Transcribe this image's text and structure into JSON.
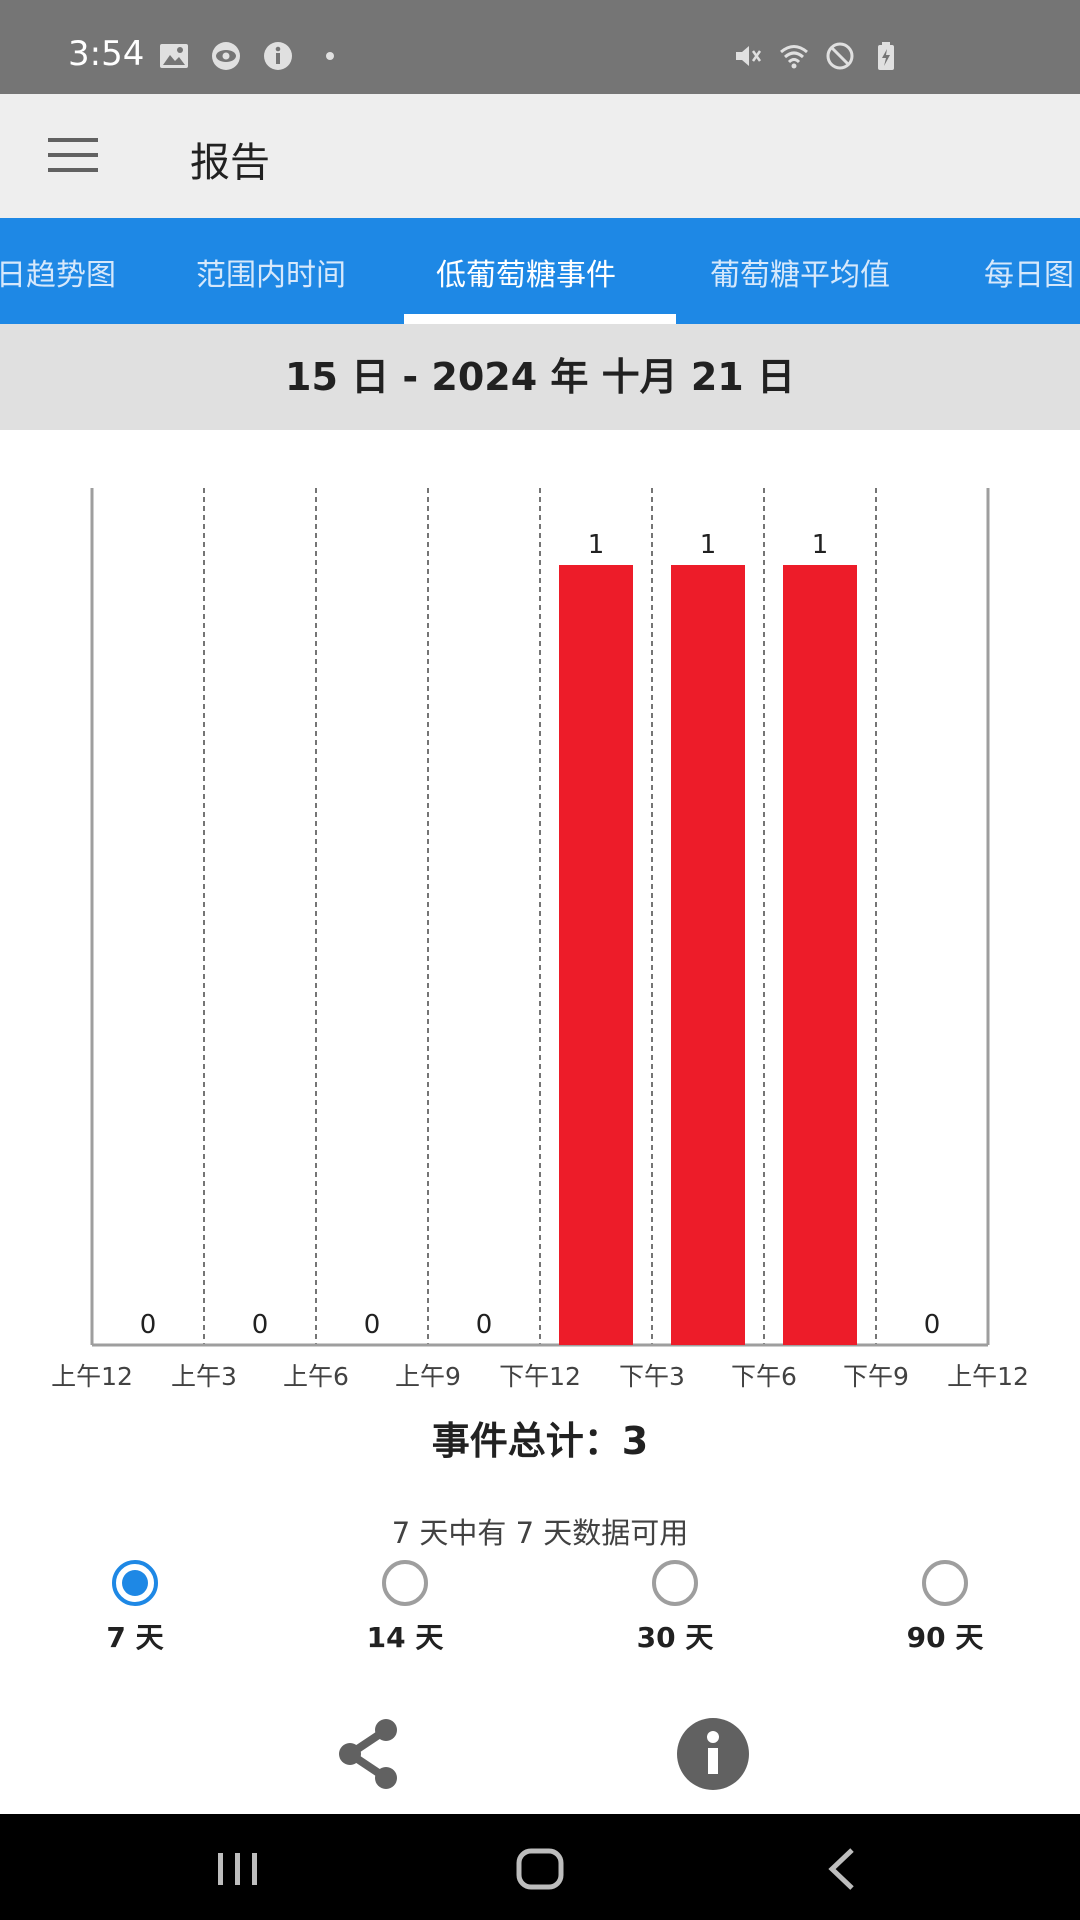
{
  "status_bar": {
    "time": "3:54",
    "left_icons": [
      "image-icon",
      "eye-icon",
      "info-icon",
      "dot-icon"
    ],
    "right_icons": [
      "mute-icon",
      "wifi-icon",
      "block-icon",
      "battery-icon"
    ]
  },
  "app_bar": {
    "menu_icon": "menu-icon",
    "title": "报告"
  },
  "tabs": [
    {
      "label": "日趋势图",
      "active": false
    },
    {
      "label": "范围内时间",
      "active": false
    },
    {
      "label": "低葡萄糖事件",
      "active": true
    },
    {
      "label": "葡萄糖平均值",
      "active": false
    },
    {
      "label": "每日图",
      "active": false
    }
  ],
  "date_range": "15 日 - 2024 年 十月 21 日",
  "chart_data": {
    "type": "bar",
    "x_tick_labels": [
      "上午12",
      "上午3",
      "上午6",
      "上午9",
      "下午12",
      "下午3",
      "下午6",
      "下午9",
      "上午12"
    ],
    "categories": [
      "上午12-上午3",
      "上午3-上午6",
      "上午6-上午9",
      "上午9-下午12",
      "下午12-下午3",
      "下午3-下午6",
      "下午6-下午9",
      "下午9-上午12"
    ],
    "values": [
      0,
      0,
      0,
      0,
      1,
      1,
      1,
      0
    ],
    "data_labels": [
      "0",
      "0",
      "0",
      "0",
      "1",
      "1",
      "1",
      "0"
    ],
    "ylim": [
      0,
      1
    ],
    "bar_color": "#ed1c29",
    "grid": "dashed vertical"
  },
  "summary": {
    "total_label": "事件总计：3",
    "availability": "7 天中有 7 天数据可用"
  },
  "range_options": [
    {
      "label": "7 天",
      "selected": true
    },
    {
      "label": "14 天",
      "selected": false
    },
    {
      "label": "30 天",
      "selected": false
    },
    {
      "label": "90 天",
      "selected": false
    }
  ],
  "actions": {
    "share_icon": "share-icon",
    "info_icon": "info-icon"
  },
  "nav_bar": {
    "icons": [
      "recent-apps-icon",
      "home-icon",
      "back-icon"
    ]
  },
  "colors": {
    "accent": "#1e88e5",
    "bar": "#ed1c29",
    "status_bar": "#757575",
    "app_bar": "#eeeeee",
    "date_band": "#e0e0e0"
  }
}
